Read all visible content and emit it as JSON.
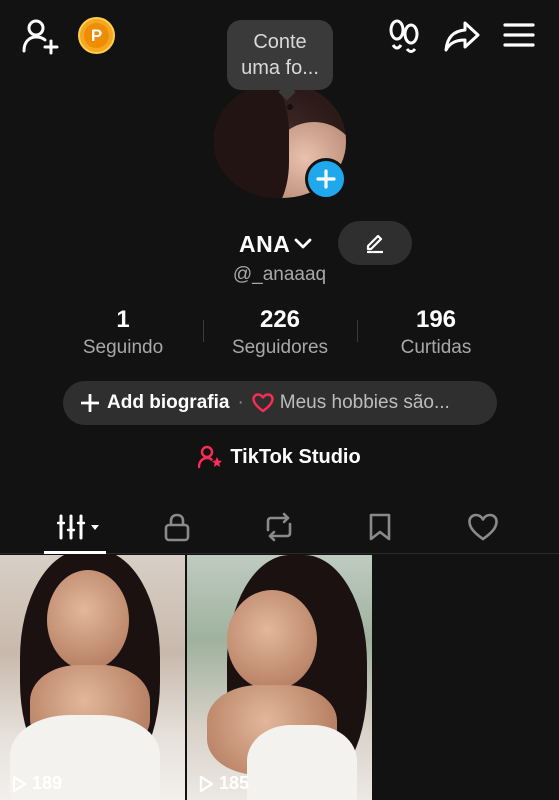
{
  "header": {
    "add_friend_icon": "person-plus-icon",
    "coin_label": "P",
    "footprints_icon": "footprints-icon",
    "share_icon": "share-arrow-icon",
    "menu_icon": "hamburger-menu-icon"
  },
  "avatar_bubble": {
    "line1": "Conte",
    "line2": "uma fo..."
  },
  "profile": {
    "name": "ANA",
    "handle": "@_anaaaq"
  },
  "stats": [
    {
      "value": "1",
      "label": "Seguindo"
    },
    {
      "value": "226",
      "label": "Seguidores"
    },
    {
      "value": "196",
      "label": "Curtidas"
    }
  ],
  "bio": {
    "add_label": "Add biografia",
    "separator": "·",
    "hobby_text": "Meus hobbies são..."
  },
  "studio": {
    "label": "TikTok Studio"
  },
  "tabs": [
    {
      "icon": "videos-grid-icon",
      "active": true
    },
    {
      "icon": "lock-icon",
      "active": false
    },
    {
      "icon": "repost-icon",
      "active": false
    },
    {
      "icon": "bookmark-icon",
      "active": false
    },
    {
      "icon": "heart-icon",
      "active": false
    }
  ],
  "videos": [
    {
      "views": "189"
    },
    {
      "views": "185"
    }
  ],
  "colors": {
    "background": "#121212",
    "pill": "#2f2f2f",
    "accent_blue": "#1fa9ec",
    "accent_pink": "#fe2c55",
    "coin": "#f5a623"
  }
}
